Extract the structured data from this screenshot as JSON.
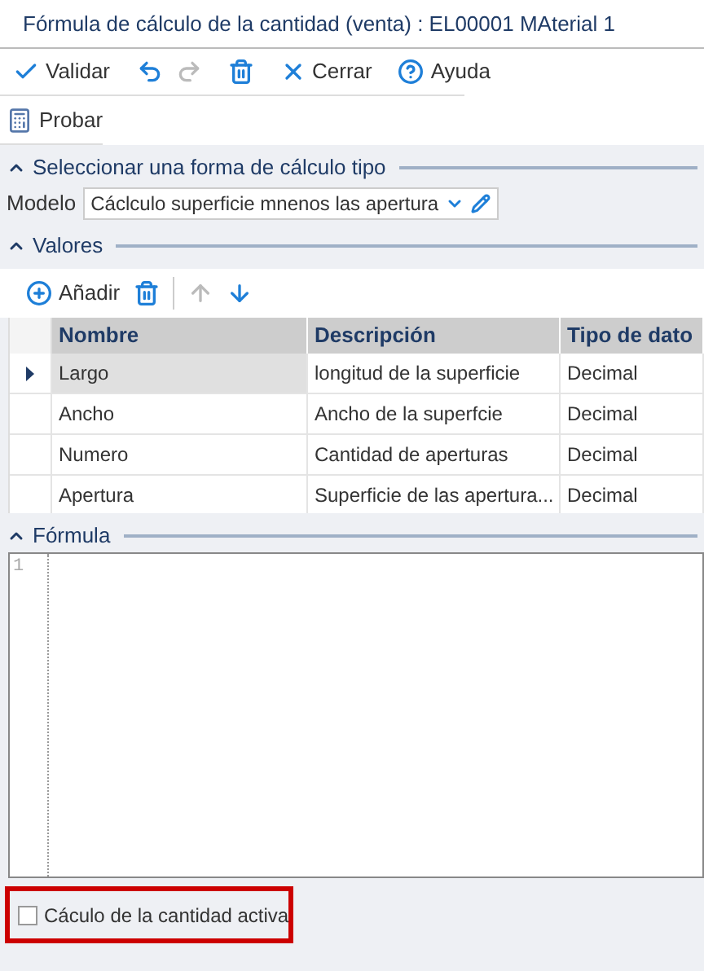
{
  "window": {
    "title": "Fórmula de cálculo de la cantidad (venta) : EL00001 MAterial 1"
  },
  "toolbar": [
    {
      "kind": "validate",
      "label": "Validar",
      "disabled": false
    },
    {
      "kind": "undo",
      "disabled": false
    },
    {
      "kind": "redo",
      "disabled": true
    },
    {
      "kind": "delete",
      "disabled": false
    },
    {
      "kind": "close",
      "label": "Cerrar",
      "disabled": false
    },
    {
      "kind": "help",
      "label": "Ayuda",
      "disabled": false
    }
  ],
  "test_button": {
    "label": "Probar"
  },
  "model_section": {
    "title": "Seleccionar una forma de cálculo tipo",
    "expanded": true,
    "label": "Modelo",
    "value": "Cáclculo superficie mnenos las apertura"
  },
  "values_section": {
    "title": "Valores",
    "expanded": true,
    "toolbar": [
      {
        "kind": "add",
        "label": "Añadir",
        "disabled": false
      },
      {
        "kind": "delete",
        "disabled": false
      },
      {
        "kind": "up",
        "disabled": true
      },
      {
        "kind": "down",
        "disabled": false
      }
    ],
    "columns": [
      "Nombre",
      "Descripción",
      "Tipo de dato"
    ],
    "rows": [
      {
        "cells": [
          "Largo",
          "longitud de la superficie",
          "Decimal"
        ],
        "selected": true
      },
      {
        "cells": [
          "Ancho",
          "Ancho de la superfcie",
          "Decimal"
        ],
        "selected": false
      },
      {
        "cells": [
          "Numero",
          "Cantidad de aperturas",
          "Decimal"
        ],
        "selected": false
      },
      {
        "cells": [
          "Apertura",
          "Superficie de las apertura...",
          "Decimal"
        ],
        "selected": false
      }
    ]
  },
  "formula_section": {
    "title": "Fórmula",
    "expanded": true,
    "line_numbers": [
      "1"
    ]
  },
  "active_checkbox": {
    "label": "Cáculo de la cantidad activa",
    "checked": false,
    "highlighted": true
  }
}
